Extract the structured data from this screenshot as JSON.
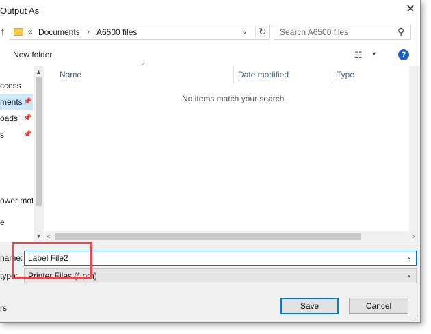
{
  "window": {
    "title": "Output As",
    "close_glyph": "✕"
  },
  "nav": {
    "up_glyph": "↑"
  },
  "address": {
    "prefix": "«",
    "crumbs": [
      "Documents",
      "A6500 files"
    ],
    "separator": "›",
    "dropdown_glyph": "⌄",
    "refresh_glyph": "↻"
  },
  "search": {
    "placeholder": "Search A6500 files",
    "icon_glyph": "⚲"
  },
  "toolbar": {
    "new_folder": "New folder",
    "view_glyph": "☷",
    "view_dropdown_glyph": "▾",
    "help_glyph": "?"
  },
  "sidebar": {
    "items": [
      {
        "label": "ccess",
        "pinned": false
      },
      {
        "label": "ments",
        "pinned": true
      },
      {
        "label": "oads",
        "pinned": true
      },
      {
        "label": "s",
        "pinned": true
      },
      {
        "label": "ower mot",
        "pinned": false
      },
      {
        "label": "e",
        "pinned": false
      }
    ],
    "pin_glyph": "📌"
  },
  "filelist": {
    "columns": [
      "Name",
      "Date modified",
      "Type"
    ],
    "sort_glyph": "^",
    "empty_message": "No items match your search."
  },
  "scroll": {
    "up": "▲",
    "down": "▼",
    "left": "<",
    "right": ">"
  },
  "form": {
    "filename_label": "name:",
    "filename_value": "Label File2",
    "filetype_label": "type:",
    "filetype_value": "Printer Files (*.prn)",
    "dropdown_glyph": "⌄",
    "folders_toggle": "rs"
  },
  "buttons": {
    "save": "Save",
    "cancel": "Cancel"
  },
  "colors": {
    "accent": "#0078d7",
    "highlight": "#e8474e",
    "selection": "#cce8ff"
  }
}
